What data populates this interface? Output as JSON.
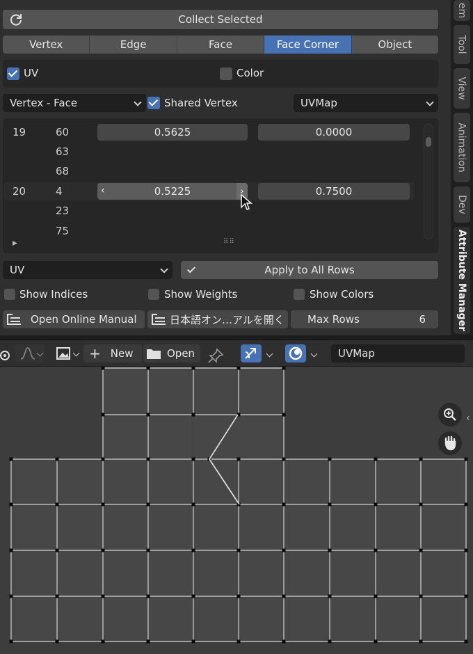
{
  "panel": {
    "collect_label": "Collect Selected",
    "domains": [
      {
        "label": "Vertex",
        "active": false
      },
      {
        "label": "Edge",
        "active": false
      },
      {
        "label": "Face",
        "active": false
      },
      {
        "label": "Face Corner",
        "active": true
      },
      {
        "label": "Object",
        "active": false
      }
    ],
    "uv_checkbox": {
      "label": "UV",
      "checked": true
    },
    "color_checkbox": {
      "label": "Color",
      "checked": false
    },
    "mode_dropdown": "Vertex - Face",
    "shared_vertex": {
      "label": "Shared Vertex",
      "checked": true
    },
    "uvmap_dropdown": "UVMap",
    "rows": [
      {
        "vertex": "19",
        "face": "60",
        "u": "0.5625",
        "v": "0.0000"
      },
      {
        "vertex": "",
        "face": "63"
      },
      {
        "vertex": "",
        "face": "68"
      },
      {
        "vertex": "20",
        "face": "4",
        "u": "0.5225",
        "v": "0.7500"
      },
      {
        "vertex": "",
        "face": "23"
      },
      {
        "vertex": "",
        "face": "75"
      }
    ],
    "type_dropdown": "UV",
    "apply_label": "Apply to All Rows",
    "show_indices": "Show Indices",
    "show_weights": "Show Weights",
    "show_colors": "Show Colors",
    "manual_label": "Open Online Manual",
    "manual_ja_label": "日本語オン…アルを開く",
    "max_rows_label": "Max Rows",
    "max_rows_value": "6"
  },
  "tabs": [
    {
      "label": "em",
      "active": false
    },
    {
      "label": "Tool",
      "active": false
    },
    {
      "label": "View",
      "active": false
    },
    {
      "label": "Animation",
      "active": false
    },
    {
      "label": "Dev",
      "active": false
    },
    {
      "label": "Attribute Manager",
      "active": true
    }
  ],
  "uv_header": {
    "new_label": "New",
    "open_label": "Open",
    "uvmap_name": "UVMap"
  },
  "colors": {
    "accent": "#4772b3",
    "panel_bg": "#2f2f2f",
    "grid_bg": "#3d3d3d",
    "face_fill": "#474747"
  },
  "icons": [
    "refresh-icon",
    "cursor-icon",
    "checkmark-icon",
    "document-icon",
    "image-icon",
    "plus-icon",
    "folder-icon",
    "pin-icon",
    "uv-sync-icon",
    "sticky-select-icon",
    "zoom-icon",
    "hand-icon"
  ]
}
